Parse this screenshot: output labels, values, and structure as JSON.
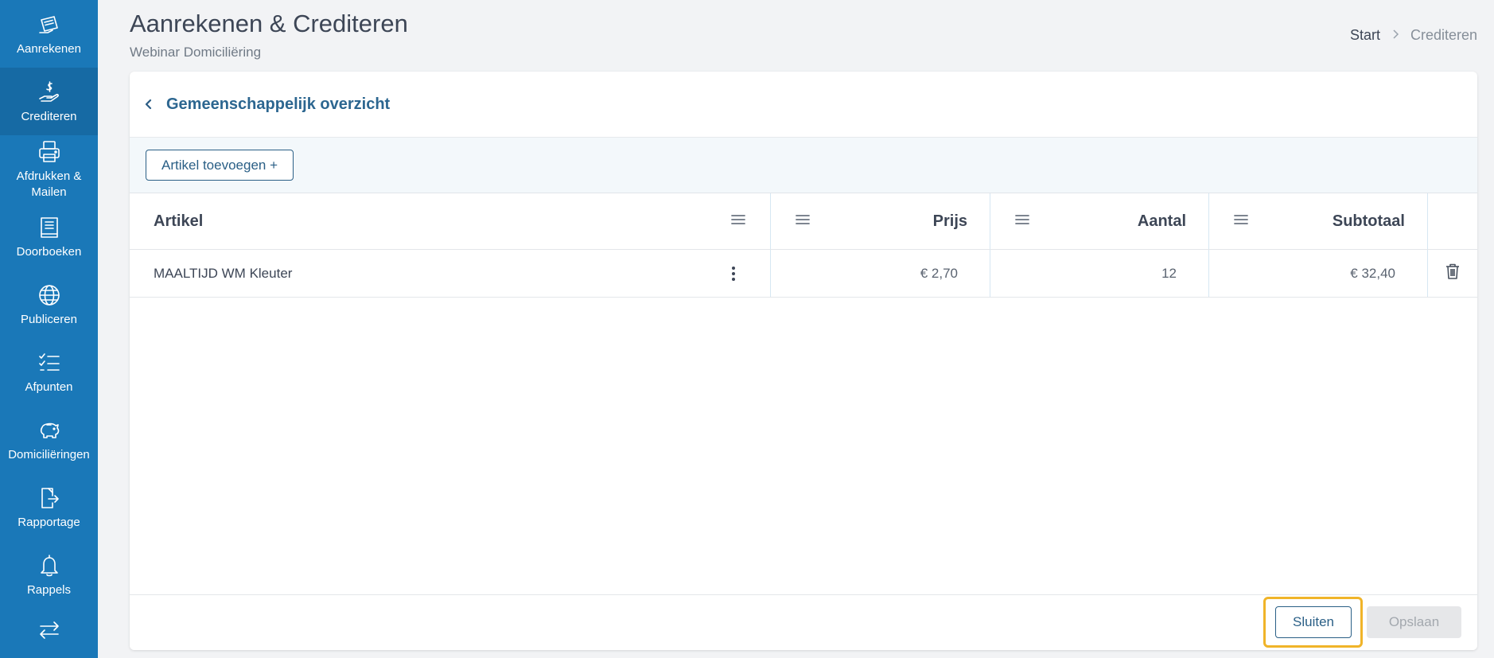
{
  "sidebar": {
    "items": [
      {
        "label": "Aanrekenen",
        "icon": "invoice-hand-icon"
      },
      {
        "label": "Crediteren",
        "icon": "dollar-hand-icon",
        "active": true
      },
      {
        "label": "Afdrukken & Mailen",
        "icon": "printer-icon"
      },
      {
        "label": "Doorboeken",
        "icon": "book-icon"
      },
      {
        "label": "Publiceren",
        "icon": "globe-icon"
      },
      {
        "label": "Afpunten",
        "icon": "checklist-icon"
      },
      {
        "label": "Domiciliëringen",
        "icon": "piggy-bank-icon"
      },
      {
        "label": "Rapportage",
        "icon": "report-export-icon"
      },
      {
        "label": "Rappels",
        "icon": "bell-icon"
      },
      {
        "label": "",
        "icon": "transfer-arrows-icon"
      }
    ]
  },
  "header": {
    "title": "Aanrekenen & Crediteren",
    "subtitle": "Webinar Domiciliëring",
    "breadcrumb": [
      "Start",
      "Crediteren"
    ]
  },
  "card": {
    "title": "Gemeenschappelijk overzicht",
    "add_button": "Artikel toevoegen +"
  },
  "table": {
    "columns": [
      "Artikel",
      "Prijs",
      "Aantal",
      "Subtotaal"
    ],
    "rows": [
      {
        "artikel": "MAALTIJD WM Kleuter",
        "prijs": "€ 2,70",
        "aantal": "12",
        "subtotaal": "€ 32,40"
      }
    ]
  },
  "footer": {
    "close_label": "Sluiten",
    "save_label": "Opslaan"
  },
  "colors": {
    "sidebar": "#1a78b8",
    "sidebar_active": "#166aa4",
    "accent": "#2a5f86",
    "focus_ring": "#f0b429"
  }
}
